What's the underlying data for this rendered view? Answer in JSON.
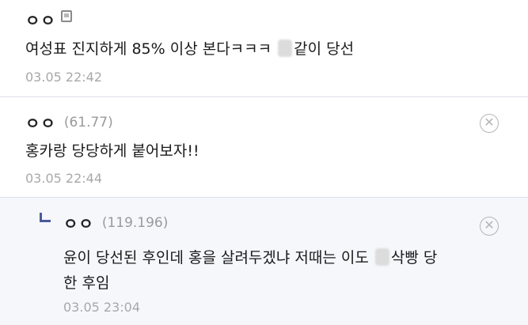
{
  "comments": [
    {
      "nick": "ㅇㅇ",
      "ip": "",
      "text_before": "여성표 진지하게 85% 이상 본다ㅋㅋㅋ",
      "text_after": "같이 당선",
      "date": "03.05 22:42",
      "has_mobile_icon": true
    },
    {
      "nick": "ㅇㅇ",
      "ip": "(61.77)",
      "text": "홍카랑 당당하게 붙어보자!!",
      "date": "03.05 22:44"
    },
    {
      "nick": "ㅇㅇ",
      "ip": "(119.196)",
      "text_line1_before": "윤이 당선된 후인데 홍을 살려두겠냐 저때는 이도",
      "text_line1_after": "삭빵 당",
      "text_line2": "한 후임",
      "date": "03.05 23:04",
      "is_reply": true
    }
  ],
  "icons": {
    "delete": "circle-x-icon",
    "mobile": "mobile-write-icon",
    "reply": "reply-arrow-icon"
  },
  "colors": {
    "reply_bg": "#f6f7fb",
    "reply_mark": "#4a5a99",
    "meta_gray": "#a8a8a8"
  }
}
